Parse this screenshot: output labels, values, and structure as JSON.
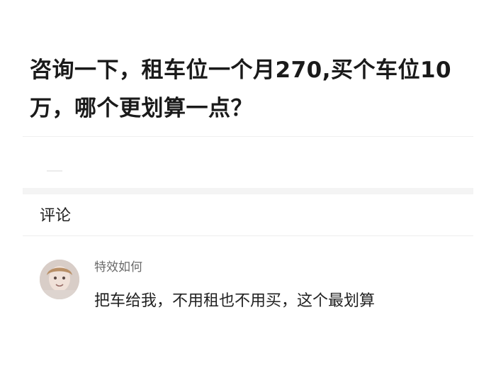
{
  "question": {
    "title": "咨询一下，租车位一个月270,买个车位10万，哪个更划算一点？"
  },
  "comments": {
    "heading": "评论",
    "items": [
      {
        "author": "特效如何",
        "text": "把车给我，不用租也不用买，这个最划算",
        "avatar_icon": "user-avatar"
      }
    ]
  }
}
